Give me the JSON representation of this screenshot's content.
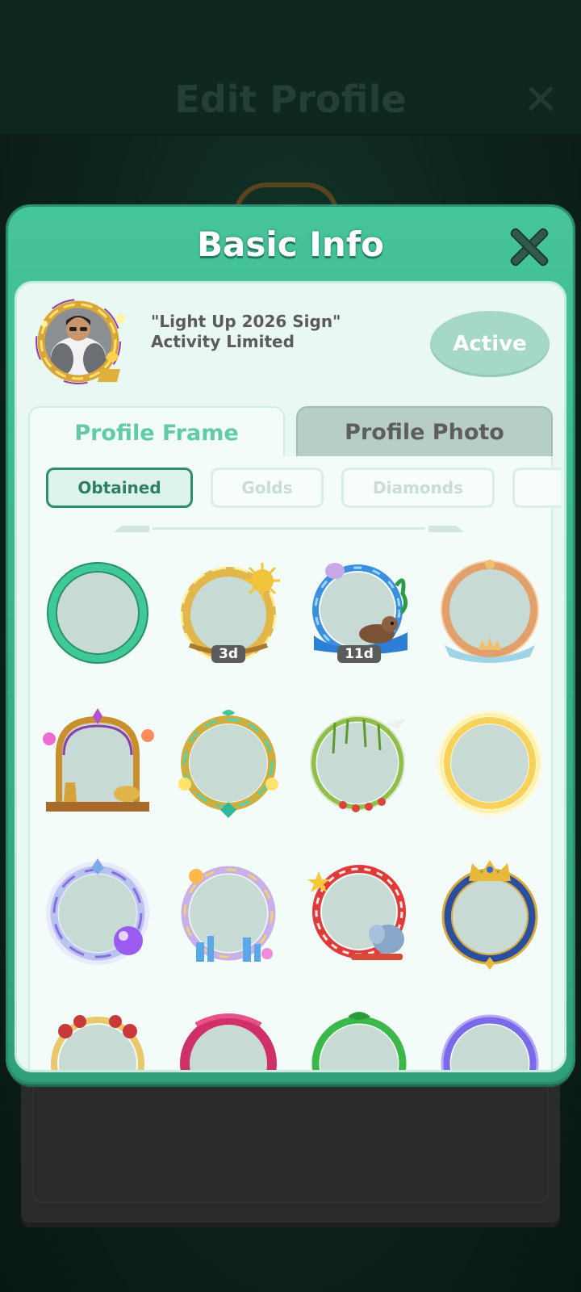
{
  "background": {
    "title": "Edit Profile"
  },
  "modal": {
    "title": "Basic Info",
    "current_frame": {
      "name": "\"Light Up 2026 Sign\"",
      "source": "Activity Limited",
      "status_button": "Active"
    },
    "tabs": [
      {
        "label": "Profile Frame",
        "selected": true
      },
      {
        "label": "Profile Photo",
        "selected": false
      }
    ],
    "filters": [
      {
        "label": "Obtained",
        "selected": true
      },
      {
        "label": "Golds",
        "selected": false
      },
      {
        "label": "Diamonds",
        "selected": false
      },
      {
        "label": "",
        "selected": false
      }
    ],
    "frames": [
      {
        "icon": "plain-green-ring-frame-icon",
        "badge": ""
      },
      {
        "icon": "golden-sun-frame-icon",
        "badge": "3d"
      },
      {
        "icon": "otter-water-frame-icon",
        "badge": "11d"
      },
      {
        "icon": "rose-gold-crown-frame-icon",
        "badge": ""
      },
      {
        "icon": "lantern-arch-frame-icon",
        "badge": ""
      },
      {
        "icon": "jade-gold-frame-icon",
        "badge": ""
      },
      {
        "icon": "vine-bird-frame-icon",
        "badge": ""
      },
      {
        "icon": "golden-glow-frame-icon",
        "badge": ""
      },
      {
        "icon": "crystal-orb-frame-icon",
        "badge": ""
      },
      {
        "icon": "city-fireworks-frame-icon",
        "badge": ""
      },
      {
        "icon": "circus-elephant-frame-icon",
        "badge": ""
      },
      {
        "icon": "royal-blue-crown-frame-icon",
        "badge": ""
      },
      {
        "icon": "red-roses-frame-icon",
        "badge": ""
      },
      {
        "icon": "pink-ribbon-frame-icon",
        "badge": ""
      },
      {
        "icon": "green-leaf-frame-icon",
        "badge": ""
      },
      {
        "icon": "neon-violet-frame-icon",
        "badge": ""
      }
    ]
  },
  "colors": {
    "accent_green": "#46c49a",
    "selected_tab_text": "#5fcca4",
    "badge_bg": "#5b5b5b"
  }
}
